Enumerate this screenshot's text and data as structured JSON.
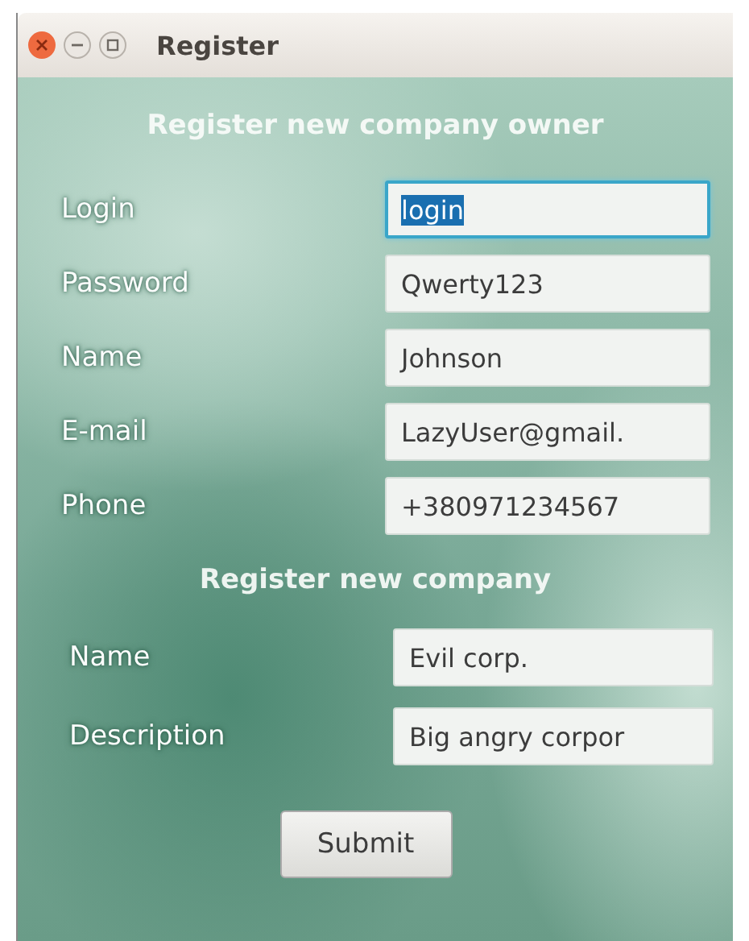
{
  "window": {
    "title": "Register"
  },
  "sections": [
    {
      "title": "Register new company owner",
      "fields": [
        {
          "label": "Login",
          "value": "login",
          "focused": true
        },
        {
          "label": "Password",
          "value": "Qwerty123",
          "focused": false
        },
        {
          "label": "Name",
          "value": "Johnson",
          "focused": false
        },
        {
          "label": "E-mail",
          "value": "LazyUser@gmail.",
          "focused": false
        },
        {
          "label": "Phone",
          "value": "+380971234567",
          "focused": false
        }
      ]
    },
    {
      "title": "Register new company",
      "fields": [
        {
          "label": "Name",
          "value": "Evil corp.",
          "focused": false
        },
        {
          "label": "Description",
          "value": "Big angry corpor",
          "focused": false
        }
      ]
    }
  ],
  "submit_button": {
    "label": "Submit"
  }
}
